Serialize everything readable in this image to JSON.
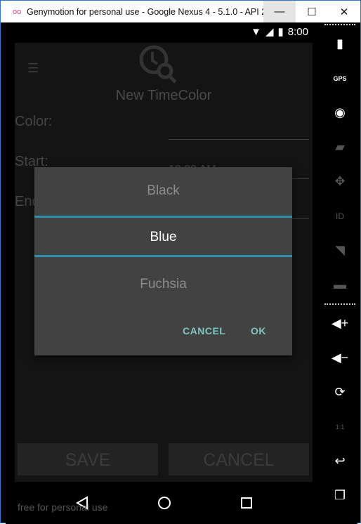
{
  "window": {
    "title": "Genymotion for personal use - Google Nexus 4 - 5.1.0 - API 2...",
    "logo": "oo",
    "minimize": "—",
    "maximize": "☐",
    "close": "✕"
  },
  "status": {
    "time": "8:00"
  },
  "app": {
    "title": "New TimeColor",
    "color_label": "Color:",
    "start_label": "Start:",
    "end_label": "End:",
    "start_value": "12:00 AM",
    "save": "SAVE",
    "cancel": "CANCEL"
  },
  "dialog": {
    "options": [
      "Black",
      "Blue",
      "Fuchsia"
    ],
    "selected": "Blue",
    "cancel": "CANCEL",
    "ok": "OK",
    "accent": "#2d8fb0"
  },
  "watermark": "free for personal use",
  "sidebar": {
    "gps": "GPS",
    "id": "ID",
    "ratio": "1:1"
  }
}
